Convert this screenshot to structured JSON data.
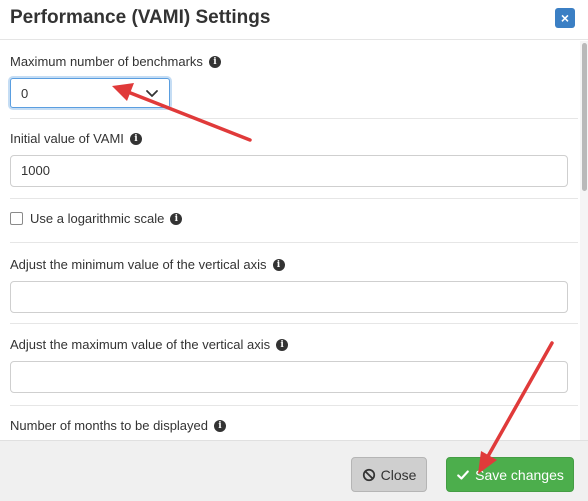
{
  "modal": {
    "title": "Performance (VAMI) Settings",
    "close_x": "×"
  },
  "fields": {
    "max_benchmarks": {
      "label": "Maximum number of benchmarks",
      "value": "0"
    },
    "initial_vami": {
      "label": "Initial value of VAMI",
      "value": "1000"
    },
    "log_scale": {
      "label": "Use a logarithmic scale",
      "checked": false
    },
    "min_axis": {
      "label": "Adjust the minimum value of the vertical axis",
      "value": ""
    },
    "max_axis": {
      "label": "Adjust the maximum value of the vertical axis",
      "value": ""
    },
    "months": {
      "label": "Number of months to be displayed"
    }
  },
  "info_glyph": "i",
  "footer": {
    "close_label": "Close",
    "save_label": "Save changes"
  },
  "colors": {
    "accent": "#3b7fc4",
    "save": "#4cae4c",
    "annotation_arrow": "#e03a3a"
  },
  "icons": {
    "close": "ban-icon",
    "save": "check-icon",
    "info": "info-circle-icon"
  }
}
